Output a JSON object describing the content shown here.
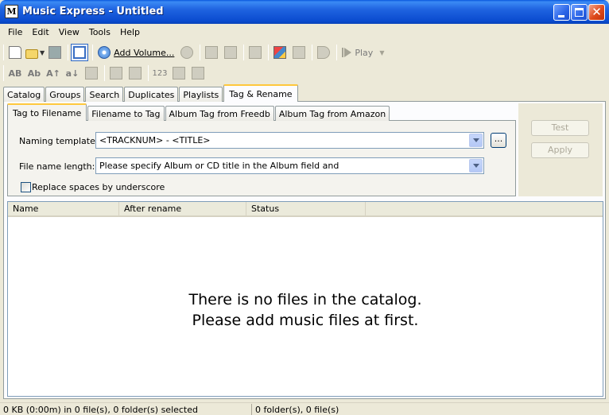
{
  "window": {
    "title": "Music Express - Untitled",
    "app_icon_letter": "M"
  },
  "menu": [
    "File",
    "Edit",
    "View",
    "Tools",
    "Help"
  ],
  "toolbar": {
    "add_volume_label": "Add Volume...",
    "play_label": "Play"
  },
  "toolbar2_text_icons": [
    "AB",
    "Ab",
    "A↑",
    "a↓",
    "123"
  ],
  "main_tabs": [
    "Catalog",
    "Groups",
    "Search",
    "Duplicates",
    "Playlists",
    "Tag & Rename"
  ],
  "sub_tabs": [
    "Tag to Filename",
    "Filename to Tag",
    "Album Tag from Freedb",
    "Album Tag from Amazon"
  ],
  "form": {
    "naming_template_label": "Naming template:",
    "naming_template_value": "<TRACKNUM> - <TITLE>",
    "file_name_length_label": "File name length:",
    "file_name_length_value": "Please specify Album or CD title in the Album field and",
    "ellipsis_label": "...",
    "replace_spaces_label": "Replace spaces by underscore",
    "replace_spaces_checked": false
  },
  "side_buttons": {
    "test": "Test",
    "apply": "Apply"
  },
  "list": {
    "columns": [
      "Name",
      "After rename",
      "Status"
    ],
    "empty_line1": "There is no files in the catalog.",
    "empty_line2": "Please add music files at first."
  },
  "status": {
    "left": "0 KB (0:00m) in 0 file(s), 0 folder(s) selected",
    "right": "0 folder(s), 0 file(s)"
  },
  "colors": {
    "titlebar": "#0A4BCF",
    "active_tab_accent": "#FFC83C",
    "window_bg": "#ECE9D8"
  }
}
